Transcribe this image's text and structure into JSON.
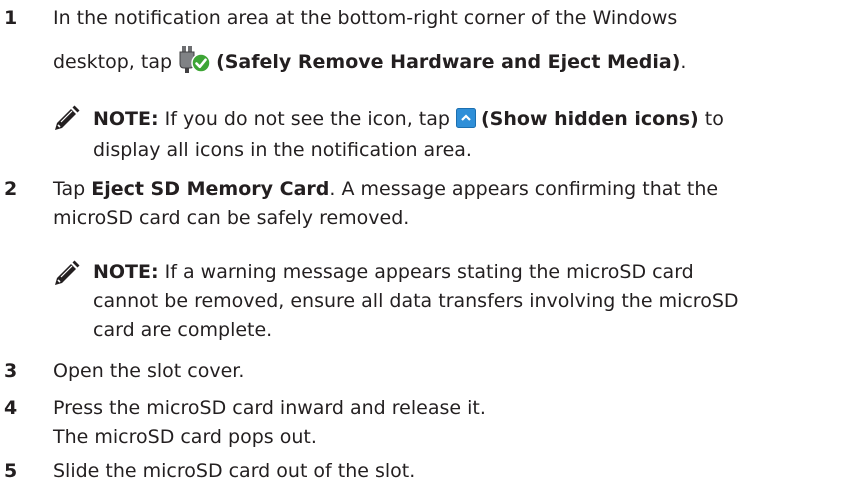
{
  "steps": [
    {
      "num": "1",
      "line1": "In the notification area at the bottom-right corner of the Windows",
      "line2_pre": "desktop, tap ",
      "line2_bold": "(Safely Remove Hardware and Eject Media)",
      "line2_post": ".",
      "icon": "safely-remove-hardware-icon"
    },
    {
      "num": "2",
      "line1_pre": "Tap ",
      "line1_bold": "Eject SD Memory Card",
      "line1_post": ". A message appears confirming that the",
      "line2": "microSD card can be safely removed."
    },
    {
      "num": "3",
      "text": "Open the slot cover."
    },
    {
      "num": "4",
      "line1": "Press the microSD card inward and release it.",
      "line2": "The microSD card pops out."
    },
    {
      "num": "5",
      "text": "Slide the microSD card out of the slot."
    }
  ],
  "notes": [
    {
      "label": "NOTE:",
      "line1_pre": " If you do not see the icon, tap ",
      "line1_bold": "(Show hidden icons)",
      "line1_post": " to",
      "line2": "display all icons in the notification area.",
      "icon": "show-hidden-icons-icon"
    },
    {
      "label": "NOTE:",
      "line1": " If a warning message appears stating the microSD card",
      "line2": "cannot be removed, ensure all data transfers involving the microSD",
      "line3": "card are complete."
    }
  ],
  "colors": {
    "text": "#231f20",
    "check_green": "#3da535",
    "show_hidden_blue": "#2f8fd8"
  }
}
